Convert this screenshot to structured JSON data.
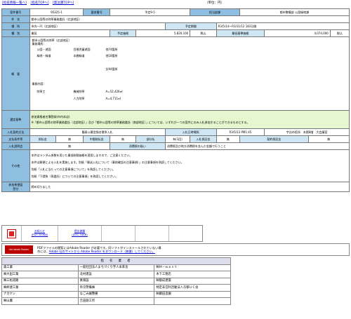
{
  "nav": {
    "links": [
      "[指名情報一覧へ]",
      "[指名TOPへ]",
      "[発注課TOPへ]"
    ],
    "unit": "（単位：円）"
  },
  "details": {
    "jigyo_no_label": "案件番号",
    "jigyo_no": "95325-1",
    "yobi_label": "要求番号",
    "yobi_value": "予定9-5",
    "dept_label": "担当部課",
    "dept_value": "都市整備部 公園緑地課",
    "name_label": "件　名",
    "name_value": "都市公園等の除草業務委託（北部地区）",
    "place_label": "場　所",
    "place_value": "市内一円（北部地区）",
    "period_label": "予定期間",
    "period_value": "R3/5/14〜R3/11/12 183日間",
    "type_label": "種　別",
    "type_value": "業局",
    "yotei_label": "予定価格",
    "yotei_value": "5,820,100",
    "yotei_tax": "税込",
    "kijun_label": "最低基準価格",
    "kijun_value": "4,074,000",
    "kijun_tax": "税込",
    "overview_label": "概　要",
    "overview": {
      "l1": "都市公園等の除草（北部地区）",
      "l2": "業務場所：",
      "l3a": "公園・遊園",
      "l3b": "目標児童遊園",
      "l3c": "他74箇所",
      "l4a": "緑地・緑道",
      "l4b": "本棚緑道",
      "l4c": "他18箇所",
      "l5": "計94箇所",
      "l6": "業務内容：",
      "l7a": "除草工",
      "l7b": "機械除草",
      "l7c": "A=52,426㎡",
      "l8b": "人力除草",
      "l8c": "A=4,711㎡"
    },
    "criteria_label": "選定基準",
    "criteria": [
      "参加資格者名簿登録(市内本店)",
      "※「都市公園等の除草業務委託（北部地区）」及び「都市公園等の除草業務委託（南部地区）」については、いずれか一つの案件にのみ入札参加することができるものとする。"
    ],
    "method_label": "入札契約方法",
    "method_value": "簡易公募型指名競争入札",
    "date_label": "入札日時場所",
    "date_value": "R3/5/13 PM1:45",
    "date_place": "宇治市役所　本館8階　大会議室",
    "pay_label": "支払条件等",
    "pay_mae_label": "前払金",
    "pay_mae_value": "無",
    "pay_chu_label": "中間前払金",
    "pay_chu_value": "無",
    "pay_bu_label": "部分払",
    "pay_bu_value": "有(1回)",
    "pay_ho_label": "入札保証金",
    "pay_ho_value": "無",
    "pay_kei_label": "契約保証金",
    "pay_kei_value": "無",
    "henko_label": "入札説明会",
    "henko_value": "無",
    "cons_label": "消費税の扱い",
    "cons_value": "消費税及び地方消費税を含んだ金額で行うこと",
    "other_label": "その他",
    "other": [
      "本件はランダム係数を用いた最低制限価格を適用しますので、ご注意ください。",
      "本件は郵便による入札を実施します。別紙「郵送入札について（事前確認の注意事項）」の注意事項を熟読してください。",
      "別紙「入札に当たっての注意事項について」を熟読してください。",
      "別紙「下請負（再委託）についての注意事項」を熟読してください。"
    ],
    "deadline_label": "参加希望届\n受付",
    "deadline_value": "締め切りました"
  },
  "attachments": [
    {
      "line1": "お知らせ",
      "line2": "(PDF:359KB)"
    },
    {
      "line1": "提出書類",
      "line2": "(DOC:34KB)"
    }
  ],
  "reader": {
    "logo": "Get Adobe Reader",
    "text1": "PDFファイルの閲覧にはAdobe Reader が必要です。同ソフトがインストールされていない場",
    "text2_prefix": "合には、",
    "text2_link": "Adobe 社のサイトから Adobe Reader をダウンロード（無償）してください。"
  },
  "bidders": {
    "header": "指　名　業　者",
    "rows": [
      [
        "森工業",
        "一般社団法人まちづくり宇人未来舎",
        "㈱Ｍ－ｗａｓｔ"
      ],
      [
        "㈱大田工業",
        "北村建設",
        "木下工務店"
      ],
      [
        "㈱三松道路",
        "真壕設",
        "㈱都成建築"
      ],
      [
        "㈱終建工業",
        "帝京警備㈱",
        "特定非営利活動法人京都ＵＣ会"
      ],
      [
        "ナカケン",
        "なごみ園整備",
        "㈱藤田造園"
      ],
      [
        "㈱山農",
        "吉田鉄工所",
        ""
      ]
    ]
  }
}
